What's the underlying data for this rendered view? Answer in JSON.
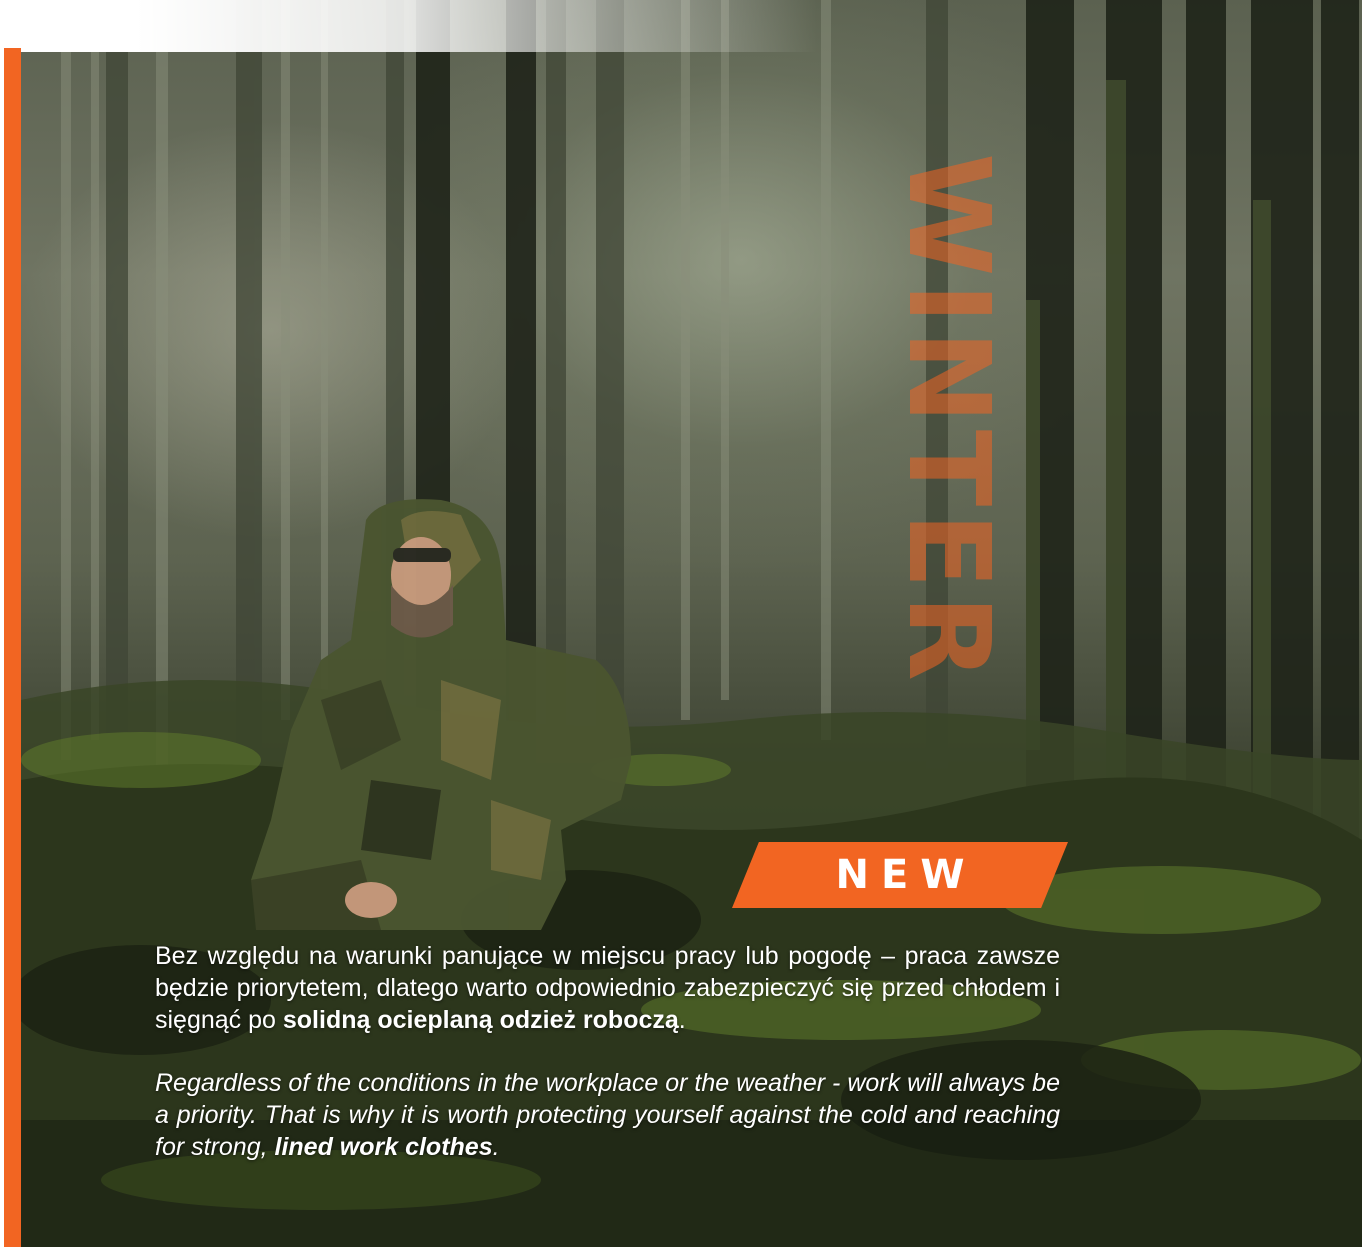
{
  "colors": {
    "accent": "#f26522",
    "text": "#ffffff"
  },
  "vertical_title": "WINTER",
  "badge": {
    "label": "NEW"
  },
  "text_pl": {
    "lead": "Bez względu na warunki panujące w miejscu pracy lub pogodę – praca zawsze będzie priorytetem, dlatego warto odpowiednio zabezpieczyć się przed chłodem i sięgnąć po ",
    "bold": "solidną ocieplaną odzież roboczą",
    "tail": "."
  },
  "text_en": {
    "lead": "Regardless of the conditions in the workplace or the weather - work will always be a priority. That is why it is worth protecting yourself against the cold and reaching for strong, ",
    "bold": "lined work clothes",
    "tail": "."
  },
  "image": {
    "scene": "forest-background",
    "subject": "man-in-camouflage-winter-jacket"
  }
}
